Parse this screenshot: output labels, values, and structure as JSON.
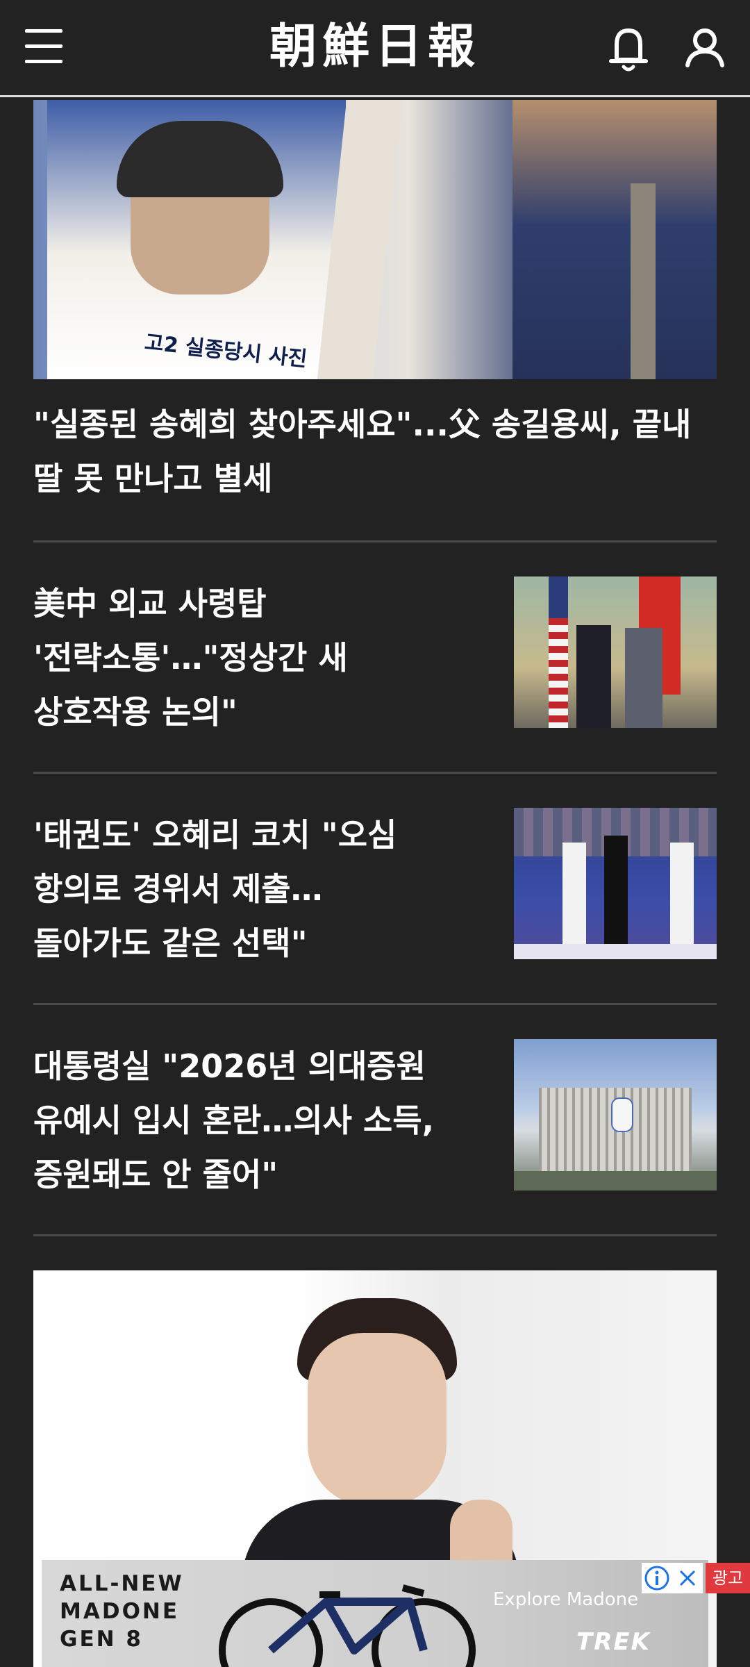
{
  "header": {
    "logo_text": "朝鮮日報"
  },
  "articles": [
    {
      "headline": "\"실종된 송혜희 찾아주세요\"...父 송길용씨, 끝내 딸 못 만나고 별세",
      "image_caption": "고2 실종당시 사진"
    },
    {
      "headline": "美中 외교 사령탑 '전략소통'…\"정상간 새 상호작용 논의\""
    },
    {
      "headline": "'태권도' 오혜리 코치 \"오심 항의로 경위서 제출… 돌아가도 같은 선택\""
    },
    {
      "headline": "대통령실 \"2026년 의대증원 유예시 입시 혼란…의사 소득, 증원돼도 안 줄어\""
    }
  ],
  "ad": {
    "title": "ALL-NEW\nMADONE\nGEN 8",
    "explore": "Explore Madone",
    "brand": "TREK",
    "label": "광고"
  },
  "colors": {
    "background": "#222222",
    "divider": "#4a4a4a",
    "ad_label": "#e03a3e"
  }
}
